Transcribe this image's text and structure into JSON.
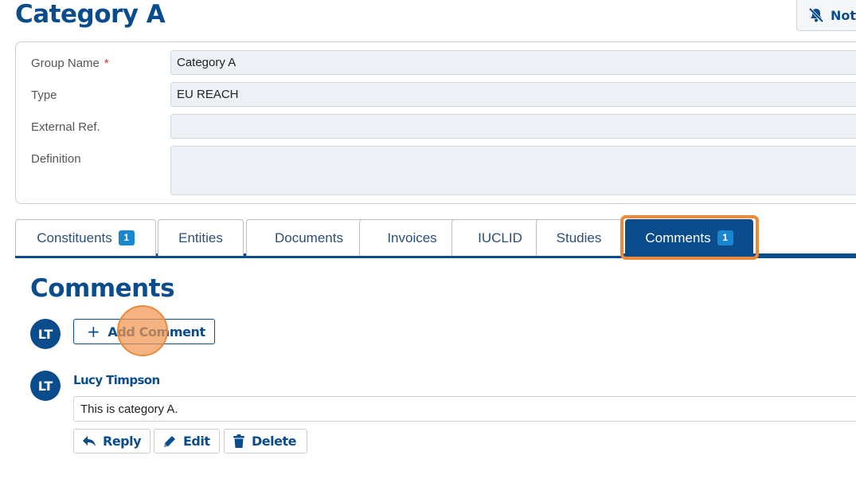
{
  "header": {
    "title": "Category A",
    "notify_label": "Not"
  },
  "details": {
    "fields": [
      {
        "label": "Group Name",
        "required": "*",
        "value": "Category A"
      },
      {
        "label": "Type",
        "value": "EU REACH"
      },
      {
        "label": "External Ref.",
        "value": ""
      },
      {
        "label": "Definition",
        "value": ""
      }
    ]
  },
  "tabs": [
    {
      "label": "Constituents",
      "badge": "1"
    },
    {
      "label": "Entities"
    },
    {
      "label": "Documents"
    },
    {
      "label": "Invoices"
    },
    {
      "label": "IUCLID"
    },
    {
      "label": "Studies"
    },
    {
      "label": "Comments",
      "badge": "1",
      "active": true
    }
  ],
  "comments": {
    "title": "Comments",
    "current_user_initials": "LT",
    "add_label": "Add Comment",
    "items": [
      {
        "initials": "LT",
        "author": "Lucy Timpson",
        "text": "This is category A.",
        "actions": {
          "reply": "Reply",
          "edit": "Edit",
          "delete": "Delete"
        }
      }
    ]
  },
  "colors": {
    "brand": "#0b4d8c",
    "badge": "#1a86d0",
    "highlight": "#e98a3c",
    "required": "#d9322b"
  }
}
